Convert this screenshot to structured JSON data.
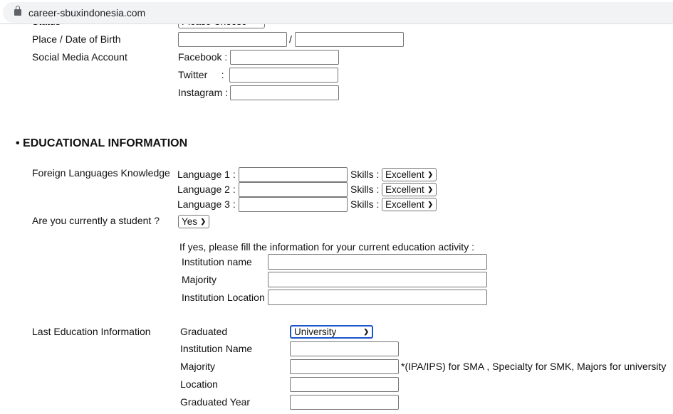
{
  "browser": {
    "url": "career-sbuxindonesia.com"
  },
  "personal": {
    "status_label": "Status",
    "status_select": "Please Choose",
    "birth_label": "Place / Date of Birth",
    "birth_sep": "/",
    "social_label": "Social Media Account",
    "facebook": "Facebook :",
    "twitter": "Twitter     :",
    "instagram": "Instagram :"
  },
  "education": {
    "heading": "• EDUCATIONAL INFORMATION",
    "languages_label": "Foreign Languages Knowledge",
    "languages": [
      {
        "label": "Language 1 :",
        "skills_label": "Skills :",
        "skill": "Excellent"
      },
      {
        "label": "Language 2 :",
        "skills_label": "Skills :",
        "skill": "Excellent"
      },
      {
        "label": "Language 3 :",
        "skills_label": "Skills :",
        "skill": "Excellent"
      }
    ],
    "student_label": "Are you currently a student ?",
    "student_value": "Yes",
    "current_intro": "If yes, please fill the information for your current education activity :",
    "current": {
      "institution": "Institution name",
      "majority": "Majority",
      "location": "Institution Location"
    },
    "last_label": "Last Education Information",
    "last": {
      "graduated": "Graduated",
      "graduated_value": "University",
      "institution": "Institution Name",
      "majority": "Majority",
      "majority_note": "*(IPA/IPS) for SMA , Specialty for SMK, Majors for university",
      "location": "Location",
      "year": "Graduated Year"
    }
  },
  "colors": {
    "focus": "#1a56c8"
  }
}
